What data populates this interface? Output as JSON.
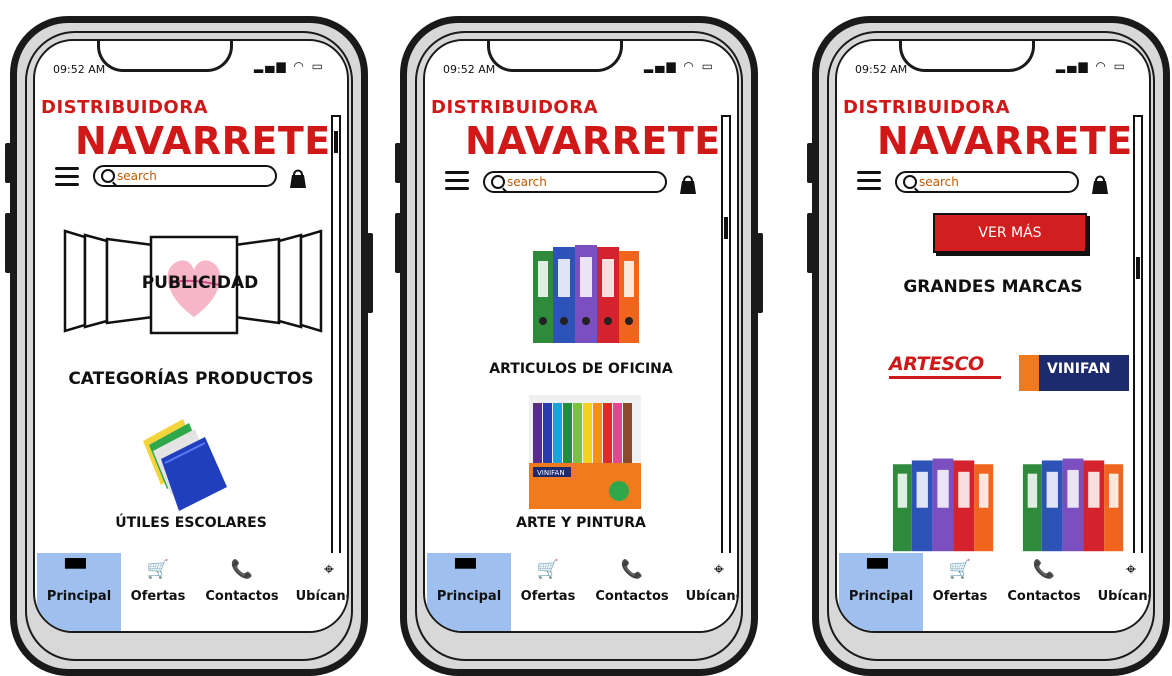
{
  "status": {
    "time": "09:52 AM"
  },
  "brand": {
    "line1": "DISTRIBUIDORA",
    "line2": "NAVARRETE"
  },
  "search": {
    "placeholder": "search"
  },
  "tabs": [
    {
      "label": "Principal",
      "icon": "store-icon",
      "active": true
    },
    {
      "label": "Ofertas",
      "icon": "cart-icon",
      "active": false
    },
    {
      "label": "Contactos",
      "icon": "phone-icon",
      "active": false
    },
    {
      "label": "Ubícanos",
      "icon": "location-icon",
      "active": false
    }
  ],
  "screen1": {
    "banner_label": "PUBLICIDAD",
    "section_title": "CATEGORÍAS PRODUCTOS",
    "category": "ÚTILES ESCOLARES"
  },
  "screen2": {
    "category1": "ARTICULOS DE OFICINA",
    "category2": "ARTE Y PINTURA",
    "marker_brand": "VINIFAN"
  },
  "screen3": {
    "button": "VER MÁS",
    "section_title": "GRANDES MARCAS",
    "brand1": "ARTESCO",
    "brand2": "VINIFAN"
  },
  "colors": {
    "brand_red": "#d01818",
    "active_tab": "#9fc0ef"
  }
}
